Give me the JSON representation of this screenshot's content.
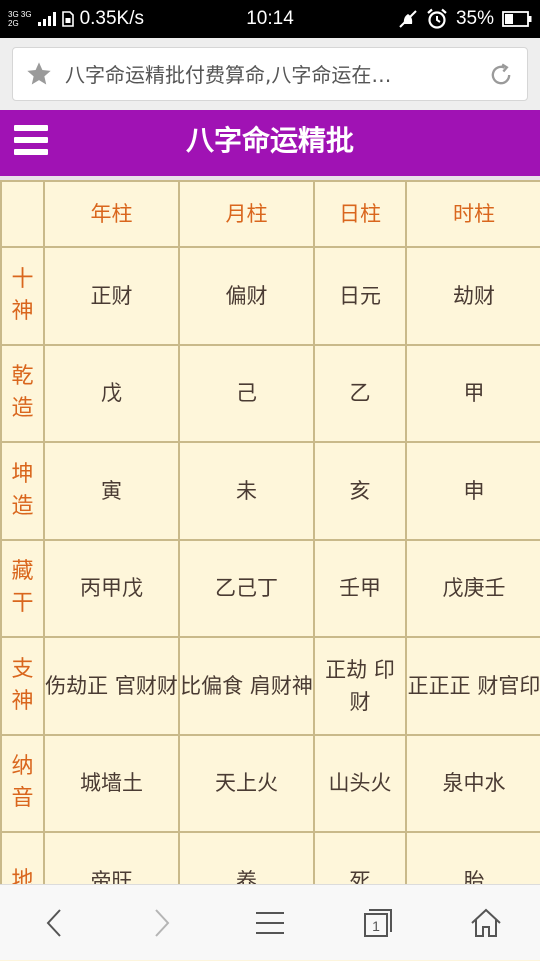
{
  "status_bar": {
    "network_top": "3G 3G",
    "network_bottom": "2G",
    "speed": "0.35K/s",
    "time": "10:14",
    "battery": "35%"
  },
  "url_bar": {
    "text": "八字命运精批付费算命,八字命运在…"
  },
  "header": {
    "title": "八字命运精批"
  },
  "table": {
    "columns": [
      "",
      "年柱",
      "月柱",
      "日柱",
      "时柱"
    ],
    "rows": [
      {
        "label": "十神",
        "cells": [
          "正财",
          "偏财",
          "日元",
          "劫财"
        ]
      },
      {
        "label": "乾造",
        "cells": [
          "戊",
          "己",
          "乙",
          "甲"
        ]
      },
      {
        "label": "坤造",
        "cells": [
          "寅",
          "未",
          "亥",
          "申"
        ]
      },
      {
        "label": "藏干",
        "cells": [
          "丙甲戊",
          "乙己丁",
          "壬甲",
          "戊庚壬"
        ]
      },
      {
        "label": "支神",
        "cells": [
          "伤劫正 官财财",
          "比偏食 肩财神",
          "正劫 印财",
          "正正正 财官印"
        ]
      },
      {
        "label": "纳音",
        "cells": [
          "城墙土",
          "天上火",
          "山头火",
          "泉中水"
        ]
      },
      {
        "label": "地",
        "cells": [
          "帝旺",
          "养",
          "死",
          "胎"
        ]
      }
    ]
  },
  "bottom_nav": {
    "tab_count": "1"
  },
  "colors": {
    "header_bg": "#a012b4",
    "accent_text": "#d9661d",
    "table_bg": "#fef6da"
  }
}
